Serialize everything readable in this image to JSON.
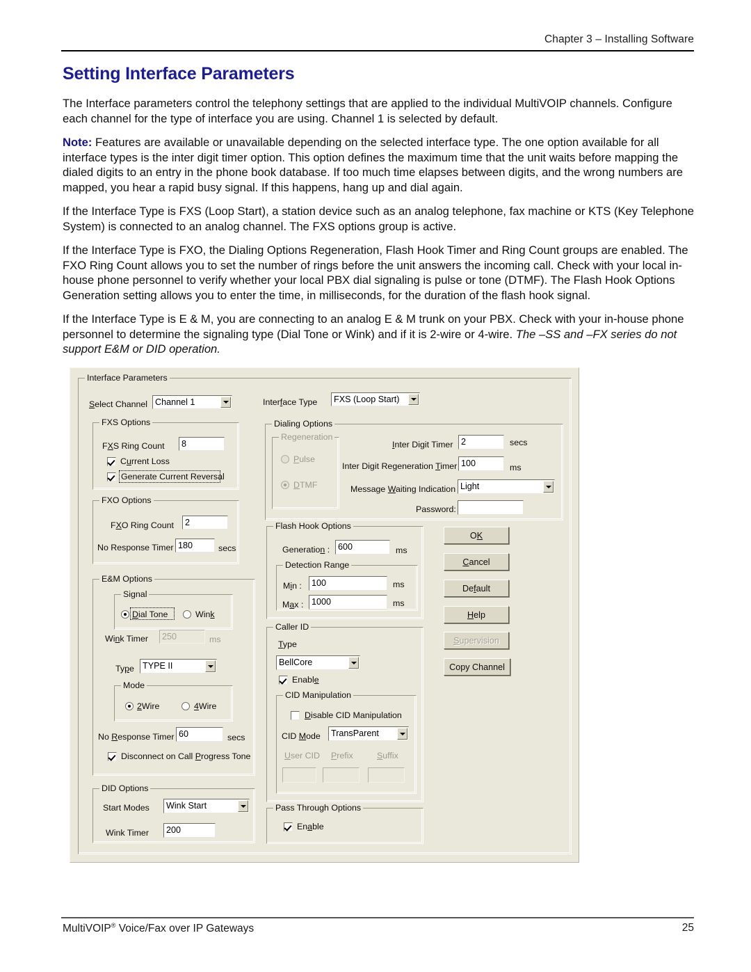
{
  "header": {
    "running_head": "Chapter 3 – Installing Software"
  },
  "title": "Setting Interface Parameters",
  "paragraphs": {
    "p1": "The Interface parameters control the telephony settings that are applied to the individual MultiVOIP channels. Configure each channel for the type of interface you are using. Channel 1 is selected by default.",
    "note_label": "Note:",
    "note_text": " Features are available or unavailable depending on the selected interface type. The one option available for all interface types is the inter digit timer option. This option defines the maximum time that the unit waits before mapping the dialed digits to an entry in the phone book database. If too much time elapses between digits, and the wrong numbers are mapped, you hear a rapid busy signal. If this happens, hang up and dial again.",
    "p3": "If the Interface Type is FXS (Loop Start), a station device such as an analog telephone, fax machine or KTS (Key Telephone System) is connected to an analog channel. The FXS options group is active.",
    "p4": "If the Interface Type is FXO, the Dialing Options Regeneration, Flash Hook Timer and Ring Count groups are enabled. The FXO Ring Count allows you to set the number of rings before the unit answers the incoming call. Check with your local in-house phone personnel to verify whether your local PBX dial signaling is pulse or tone (DTMF). The Flash Hook Options Generation setting allows you to enter the time, in milliseconds, for the duration of the flash hook signal.",
    "p5_plain": "If the Interface Type is E & M, you are connecting to an analog E & M trunk on your PBX. Check with your in-house phone personnel to determine the signaling type (Dial Tone or Wink) and if it is 2-wire or 4-wire. ",
    "p5_italic": "The –SS and –FX series do not support E&M or DID operation."
  },
  "dialog": {
    "group_caption": "Interface Parameters",
    "select_channel": {
      "label": "Select Channel",
      "value": "Channel 1"
    },
    "interface_type": {
      "label": "Interface Type",
      "value": "FXS (Loop Start)"
    },
    "fxs_options": {
      "caption": "FXS Options",
      "ring_count_label": "FXS Ring Count",
      "ring_count_value": "8",
      "current_loss_label": "Current  Loss",
      "current_loss_checked": true,
      "generate_reversal_label": "Generate Current Reversal",
      "generate_reversal_checked": true
    },
    "fxo_options": {
      "caption": "FXO Options",
      "ring_count_label": "FXO Ring Count",
      "ring_count_value": "2",
      "no_response_label": "No Response Timer",
      "no_response_value": "180",
      "no_response_unit": "secs"
    },
    "em_options": {
      "caption": "E&M Options",
      "signal_caption": "Signal",
      "signal_dial_tone": "Dial Tone",
      "signal_wink": "Wink",
      "signal_selected": "Dial Tone",
      "wink_timer_label": "Wink Timer",
      "wink_timer_value": "250",
      "wink_timer_unit": "ms",
      "type_label": "Type",
      "type_value": "TYPE II",
      "mode_caption": "Mode",
      "mode_2wire": "2Wire",
      "mode_4wire": "4Wire",
      "mode_selected": "2Wire",
      "no_response_label": "No Response Timer",
      "no_response_value": "60",
      "no_response_unit": "secs",
      "disconnect_label": "Disconnect on Call Progress Tone",
      "disconnect_checked": true
    },
    "did_options": {
      "caption": "DID Options",
      "start_modes_label": "Start Modes",
      "start_modes_value": "Wink Start",
      "wink_timer_label": "Wink Timer",
      "wink_timer_value": "200"
    },
    "dialing_options": {
      "caption": "Dialing Options",
      "regeneration_caption": "Regeneration",
      "pulse_label": "Pulse",
      "dtmf_label": "DTMF",
      "regeneration_selected": "DTMF",
      "inter_digit_timer_label": "Inter Digit Timer",
      "inter_digit_timer_value": "2",
      "inter_digit_timer_unit": "secs",
      "inter_digit_regen_label": "Inter Digit Regeneration Timer",
      "inter_digit_regen_value": "100",
      "inter_digit_regen_unit": "ms",
      "mwi_label": "Message Waiting Indication",
      "mwi_value": "Light",
      "password_label": "Password:",
      "password_value": ""
    },
    "flash_hook_options": {
      "caption": "Flash Hook Options",
      "generation_label": "Generation :",
      "generation_value": "600",
      "generation_unit": "ms",
      "detection_caption": "Detection Range",
      "min_label": "Min :",
      "min_value": "100",
      "min_unit": "ms",
      "max_label": "Max :",
      "max_value": "1000",
      "max_unit": "ms"
    },
    "caller_id": {
      "caption": "Caller ID",
      "type_label": "Type",
      "type_value": "BellCore",
      "enable_label": "Enable",
      "enable_checked": true,
      "cid_manipulation": {
        "caption": "CID Manipulation",
        "disable_label": "Disable CID Manipulation",
        "disable_checked": false,
        "cid_mode_label": "CID Mode",
        "cid_mode_value": "TransParent",
        "user_cid_label": "User CID",
        "prefix_label": "Prefix",
        "suffix_label": "Suffix",
        "user_cid_value": "",
        "prefix_value": "",
        "suffix_value": ""
      }
    },
    "pass_through_options": {
      "caption": "Pass Through Options",
      "enable_label": "Enable",
      "enable_checked": true
    },
    "buttons": {
      "ok": "OK",
      "cancel": "Cancel",
      "default": "Default",
      "help": "Help",
      "supervision": "Supervision",
      "copy_channel": "Copy Channel"
    }
  },
  "footer": {
    "left_pre": "MultiVOIP",
    "left_sup": "®",
    "left_post": " Voice/Fax over IP Gateways",
    "page_number": "25"
  },
  "colors": {
    "title": "#1d1d8e",
    "dialog_face": "#eae8da",
    "button_face": "#ddd9c8"
  }
}
